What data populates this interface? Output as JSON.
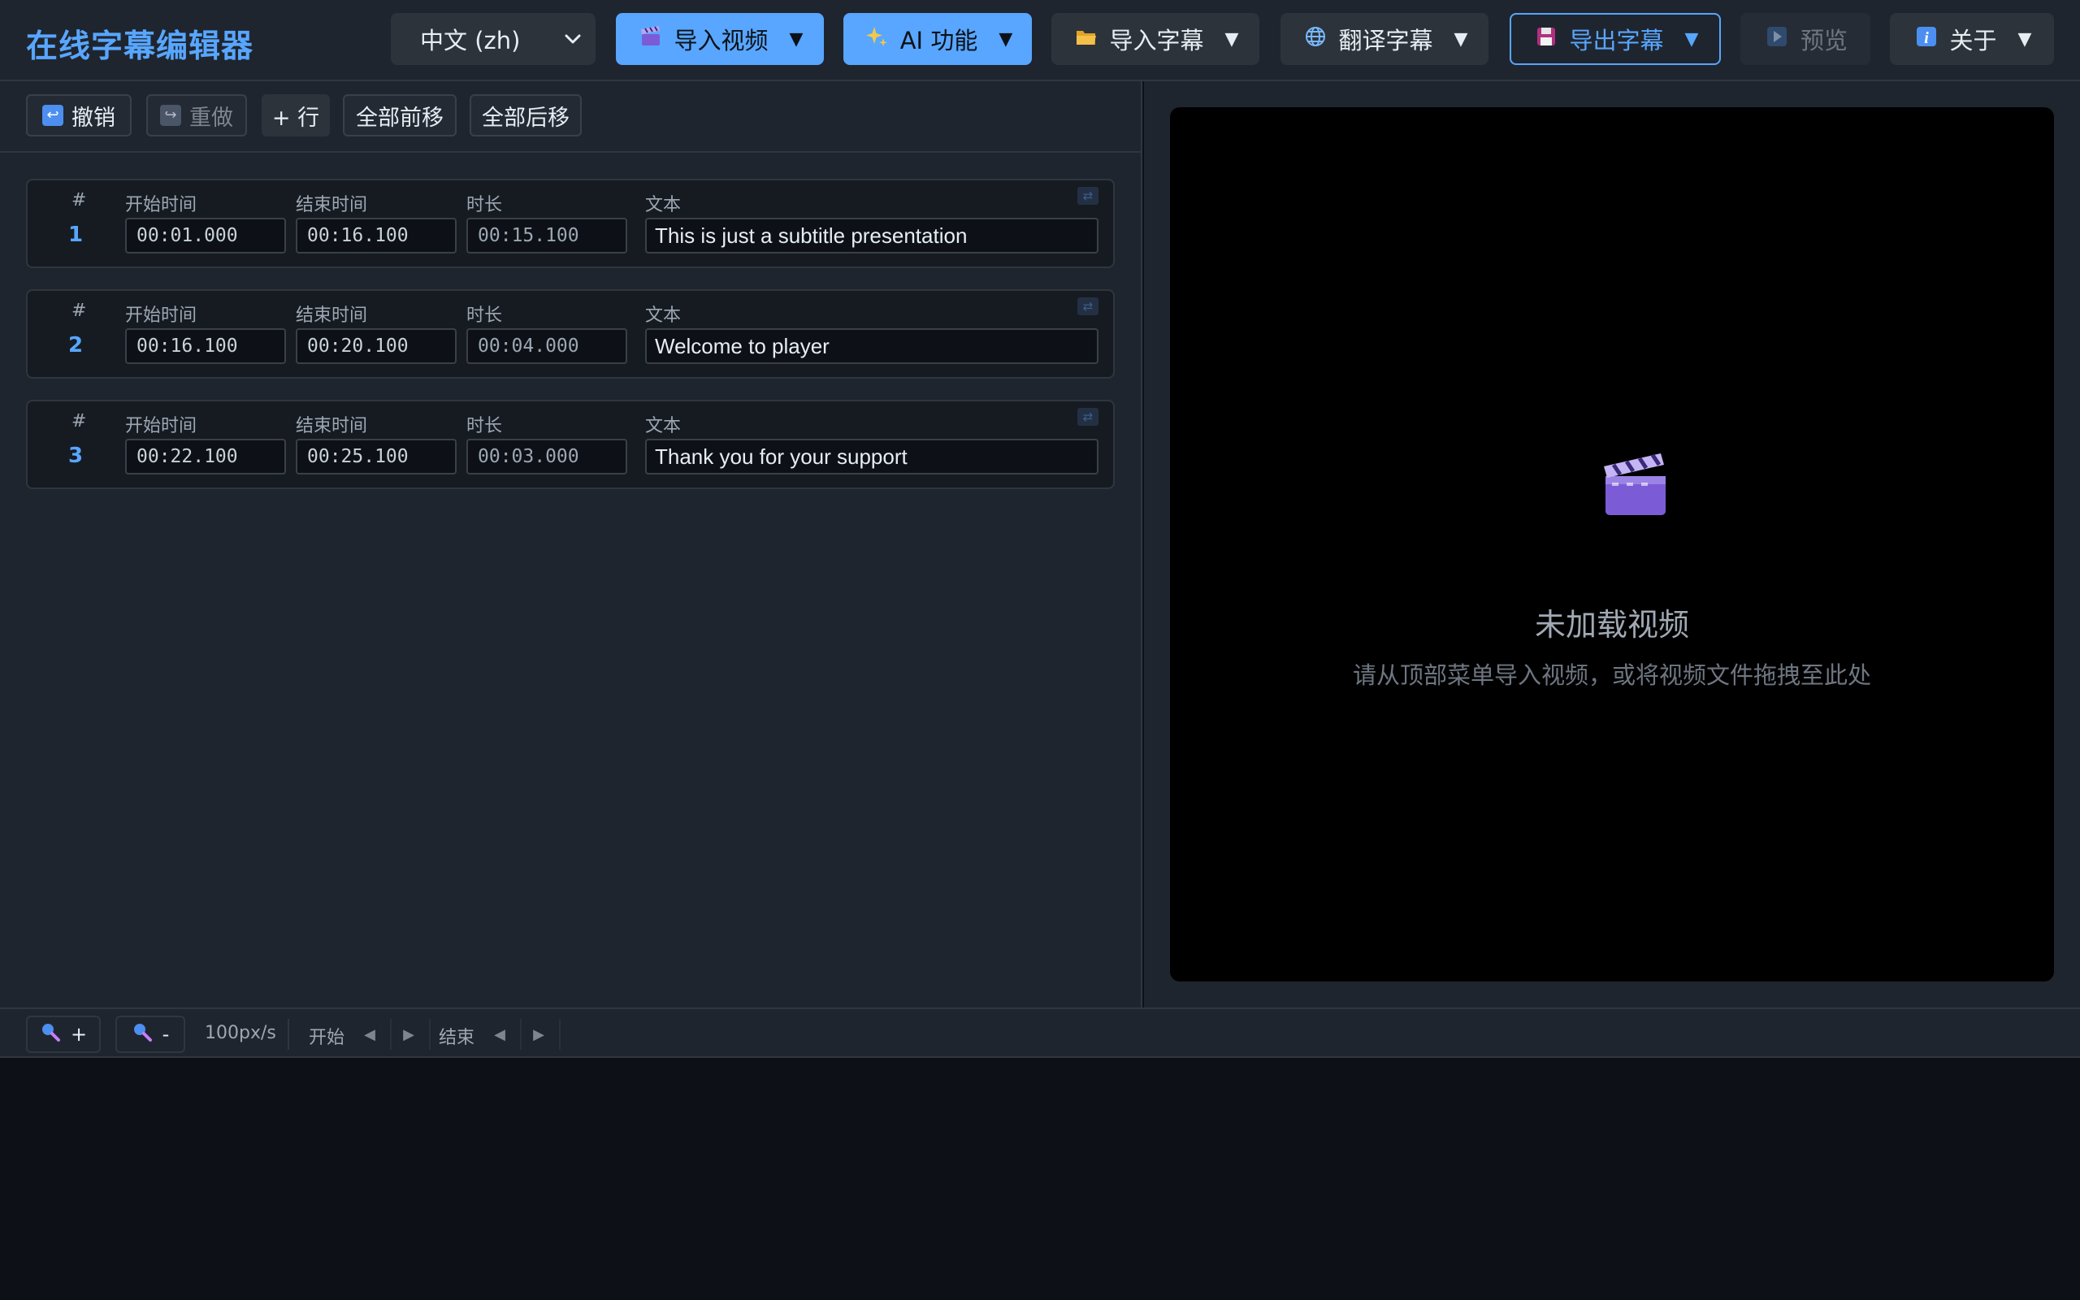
{
  "app": {
    "title": "在线字幕编辑器"
  },
  "header": {
    "language": {
      "selected": "中文 (zh)"
    },
    "buttons": [
      {
        "label": "导入视频",
        "icon": "clapper-icon",
        "caret": "▼"
      },
      {
        "label": "AI 功能",
        "icon": "sparkles-icon",
        "caret": "▼"
      },
      {
        "label": "导入字幕",
        "icon": "folder-icon",
        "caret": "▼"
      },
      {
        "label": "翻译字幕",
        "icon": "globe-icon",
        "caret": "▼"
      },
      {
        "label": "导出字幕",
        "icon": "floppy-disk-icon",
        "caret": "▼"
      },
      {
        "label": "预览",
        "icon": "play-icon"
      },
      {
        "label": "关于",
        "icon": "info-icon",
        "caret": "▼"
      }
    ]
  },
  "toolbar": {
    "undo": "撤销",
    "redo": "重做",
    "add_row": "+ 行",
    "shift_earlier": "全部前移",
    "shift_later": "全部后移"
  },
  "subtitle_labels": {
    "index": "#",
    "start": "开始时间",
    "end": "结束时间",
    "duration": "时长",
    "text": "文本"
  },
  "subtitles": [
    {
      "index": "1",
      "start": "00:01.000",
      "end": "00:16.100",
      "duration": "00:15.100",
      "text": "This is just a subtitle presentation"
    },
    {
      "index": "2",
      "start": "00:16.100",
      "end": "00:20.100",
      "duration": "00:04.000",
      "text": "Welcome to player"
    },
    {
      "index": "3",
      "start": "00:22.100",
      "end": "00:25.100",
      "duration": "00:03.000",
      "text": "Thank you for your support"
    }
  ],
  "video": {
    "placeholder_title": "未加载视频",
    "placeholder_hint": "请从顶部菜单导入视频，或将视频文件拖拽至此处"
  },
  "timeline": {
    "zoom_in": "+",
    "zoom_out": "-",
    "scale": "100px/s",
    "start_label": "开始",
    "end_label": "结束"
  },
  "colors": {
    "accent": "#58a6ff",
    "background": "#0d1117",
    "panel": "#1f252e"
  }
}
